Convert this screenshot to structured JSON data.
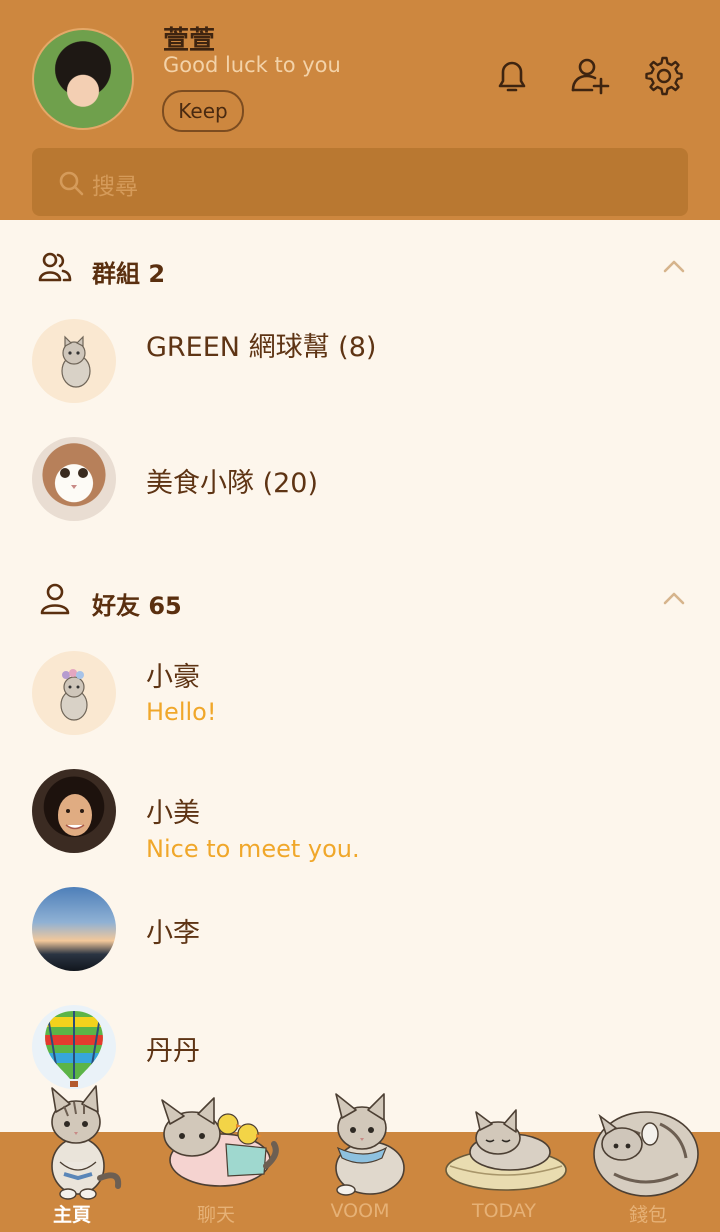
{
  "profile": {
    "name": "萱萱",
    "status": "Good luck to you",
    "keep_label": "Keep"
  },
  "header_icons": [
    "bell-icon",
    "add-friend-icon",
    "settings-gear-icon"
  ],
  "search": {
    "placeholder": "搜尋"
  },
  "groups": {
    "title": "群組 2",
    "items": [
      {
        "name": "GREEN 網球幫 (8)",
        "avatar": "cat-sticker"
      },
      {
        "name": "美食小隊 (20)",
        "avatar": "cat-photo"
      }
    ]
  },
  "friends": {
    "title": "好友 65",
    "items": [
      {
        "name": "小豪",
        "status": "Hello!",
        "avatar": "cat-with-flower-sticker"
      },
      {
        "name": "小美",
        "status": "Nice to meet you.",
        "avatar": "woman-portrait"
      },
      {
        "name": "小李",
        "status": "",
        "avatar": "sky-landscape"
      },
      {
        "name": "丹丹",
        "status": "",
        "avatar": "hot-air-balloon"
      }
    ]
  },
  "nav": {
    "items": [
      {
        "label": "主頁",
        "active": true
      },
      {
        "label": "聊天",
        "active": false
      },
      {
        "label": "VOOM",
        "active": false
      },
      {
        "label": "TODAY",
        "active": false
      },
      {
        "label": "錢包",
        "active": false
      }
    ]
  },
  "colors": {
    "header_bg": "#cd873f",
    "list_bg": "#fdf6ec",
    "name_text": "#5e3414",
    "status_text": "#f0a72a"
  }
}
